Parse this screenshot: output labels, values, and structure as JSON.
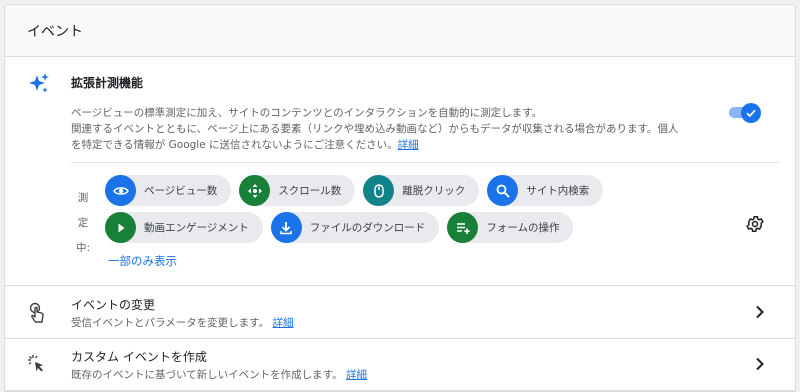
{
  "section": {
    "title": "イベント"
  },
  "enhanced": {
    "title": "拡張計測機能",
    "desc_line1": "ページビューの標準測定に加え、サイトのコンテンツとのインタラクションを自動的に測定します。",
    "desc_line2": "関連するイベントとともに、ページ上にある要素（リンクや埋め込み動画など）からもデータが収集される場合があります。個人",
    "desc_line3": "を特定できる情報が Google に送信されないようにご注意ください。",
    "details_link": "詳細",
    "toggle_on": true,
    "measuring_label": [
      "測",
      "定",
      "中:"
    ],
    "chips": [
      {
        "label": "ページビュー数",
        "icon": "eye-icon",
        "color": "#1a73e8"
      },
      {
        "label": "スクロール数",
        "icon": "move-icon",
        "color": "#188038"
      },
      {
        "label": "離脱クリック",
        "icon": "mouse-icon",
        "color": "#12828b"
      },
      {
        "label": "サイト内検索",
        "icon": "search-icon",
        "color": "#1a73e8"
      },
      {
        "label": "動画エンゲージメント",
        "icon": "play-icon",
        "color": "#188038"
      },
      {
        "label": "ファイルのダウンロード",
        "icon": "download-icon",
        "color": "#1a73e8"
      },
      {
        "label": "フォームの操作",
        "icon": "form-add-icon",
        "color": "#188038"
      }
    ],
    "show_some": "一部のみ表示",
    "accent": "#1a73e8"
  },
  "rows": [
    {
      "title": "イベントの変更",
      "subtitle": "受信イベントとパラメータを変更します。",
      "link": "詳細",
      "icon": "touch-icon"
    },
    {
      "title": "カスタム イベントを作成",
      "subtitle": "既存のイベントに基づいて新しいイベントを作成します。",
      "link": "詳細",
      "icon": "click-icon"
    }
  ]
}
